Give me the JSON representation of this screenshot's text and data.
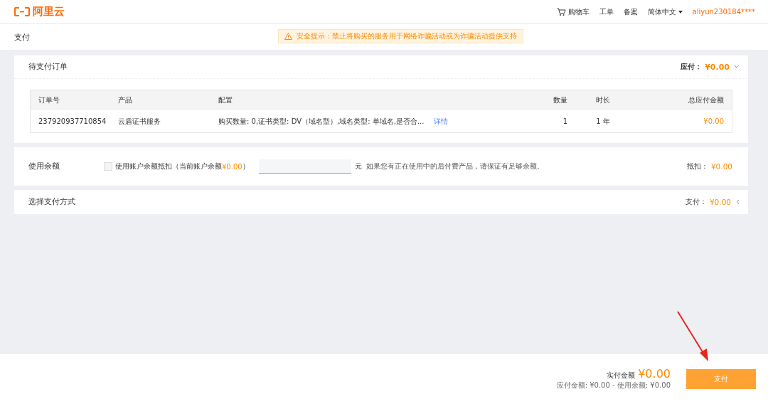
{
  "header": {
    "logo_text": "阿里云",
    "nav": [
      "购物车",
      "工单",
      "备案"
    ],
    "language": "简体中文",
    "user": "aliyun230184****"
  },
  "subheader": {
    "title": "支付",
    "notice": "安全提示：禁止将购买的服务用于网络诈骗活动或为诈骗活动提供支持"
  },
  "order": {
    "title": "待支付订单",
    "expanded": true,
    "summary_label": "应付：",
    "summary_value": "¥0.00",
    "columns": [
      "订单号",
      "产品",
      "配置",
      "数量",
      "时长",
      "总应付金额"
    ],
    "rows": [
      {
        "order_no": "237920937710854",
        "product": "云盾证书服务",
        "config": "购买数量: 0,证书类型: DV（域名型）,域名类型: 单域名,是否合...",
        "details_link": "详情",
        "quantity": "1",
        "duration": "1 年",
        "amount": "¥0.00"
      }
    ]
  },
  "balance": {
    "title": "使用余额",
    "checked": false,
    "checkbox_label": "使用账户余额抵扣（当前账户余额 ",
    "current_balance": "¥0.00",
    "checkbox_suffix": "）",
    "unit": "元",
    "hint": "如果您有正在使用中的后付费产品，请保证有足够余额。",
    "deduct_label": "抵扣：",
    "deduct_value": "¥0.00"
  },
  "payment": {
    "title": "选择支付方式",
    "expanded": false,
    "label": "支付：",
    "value": "¥0.00"
  },
  "footer": {
    "actual_label": "实付金额",
    "actual_value": "¥0.00",
    "breakdown": "应付金额: ¥0.00 - 使用余额:  ¥0.00",
    "pay_button": "支付"
  }
}
